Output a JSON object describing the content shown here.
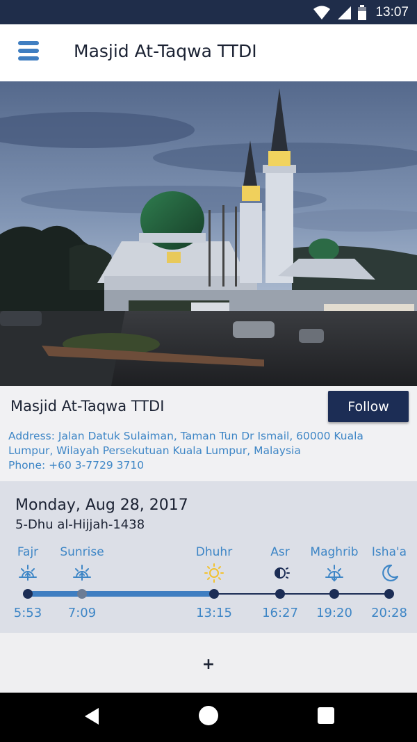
{
  "status_bar": {
    "time": "13:07"
  },
  "app_bar": {
    "title": "Masjid At-Taqwa TTDI"
  },
  "mosque": {
    "name": "Masjid At-Taqwa TTDI",
    "follow_label": "Follow",
    "address_line1": "Address: Jalan Datuk Sulaiman, Taman Tun Dr Ismail, 60000 Kuala",
    "address_line2": "Lumpur, Wilayah Persekutuan Kuala Lumpur, Malaysia",
    "phone": "Phone: +60 3-7729 3710"
  },
  "prayer_times": {
    "date_gregorian": "Monday, Aug 28, 2017",
    "date_hijri": "5-Dhu al-Hijjah-1438",
    "progress_passed": 3,
    "prayers": [
      {
        "name": "Fajr",
        "time": "5:53",
        "icon": "sunrise-up-icon"
      },
      {
        "name": "Sunrise",
        "time": "7:09",
        "icon": "sunrise-up-icon"
      },
      {
        "name": "Dhuhr",
        "time": "13:15",
        "icon": "sun-icon"
      },
      {
        "name": "Asr",
        "time": "16:27",
        "icon": "half-sun-icon"
      },
      {
        "name": "Maghrib",
        "time": "19:20",
        "icon": "sunset-down-icon"
      },
      {
        "name": "Isha'a",
        "time": "20:28",
        "icon": "moon-icon"
      }
    ]
  },
  "add_area": {
    "label": "+"
  },
  "colors": {
    "accent": "#3e86c6",
    "header_dark": "#1f2d4a",
    "follow_button": "#1c2d55",
    "sun_yellow": "#f2c230",
    "timeline_dark": "#1c2d55",
    "timeline_progress": "#3f7ec1"
  }
}
